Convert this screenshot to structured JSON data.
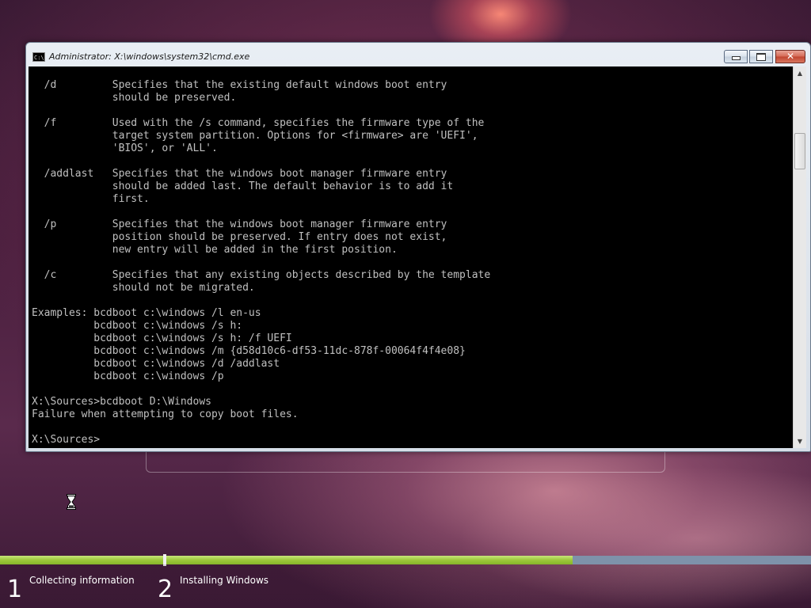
{
  "window": {
    "title": "Administrator: X:\\windows\\system32\\cmd.exe",
    "icon_name": "cmd-icon",
    "icon_text": "C:\\"
  },
  "controls": {
    "minimize": "minimize-icon",
    "maximize": "maximize-icon",
    "close": "close-icon",
    "close_glyph": "✕"
  },
  "console": {
    "text": "  /d         Specifies that the existing default windows boot entry\n             should be preserved.\n\n  /f         Used with the /s command, specifies the firmware type of the\n             target system partition. Options for <firmware> are 'UEFI',\n             'BIOS', or 'ALL'.\n\n  /addlast   Specifies that the windows boot manager firmware entry\n             should be added last. The default behavior is to add it\n             first.\n\n  /p         Specifies that the windows boot manager firmware entry\n             position should be preserved. If entry does not exist,\n             new entry will be added in the first position.\n\n  /c         Specifies that any existing objects described by the template\n             should not be migrated.\n\nExamples: bcdboot c:\\windows /l en-us\n          bcdboot c:\\windows /s h:\n          bcdboot c:\\windows /s h: /f UEFI\n          bcdboot c:\\windows /m {d58d10c6-df53-11dc-878f-00064f4f4e08}\n          bcdboot c:\\windows /d /addlast\n          bcdboot c:\\windows /p\n\nX:\\Sources>bcdboot D:\\Windows\nFailure when attempting to copy boot files.\n\nX:\\Sources>",
    "colors": {
      "background": "#000000",
      "foreground": "#c0c0c0"
    }
  },
  "scrollbar": {
    "up_glyph": "▲",
    "down_glyph": "▼"
  },
  "setup": {
    "steps": [
      {
        "number": "1",
        "label": "Collecting information",
        "progress": 1.0
      },
      {
        "number": "2",
        "label": "Installing Windows",
        "progress": 0.63
      }
    ],
    "colors": {
      "progress_fill": "#9cc83a",
      "progress_track": "#7e92aa"
    }
  },
  "cursor": {
    "icon_name": "hourglass-icon"
  }
}
